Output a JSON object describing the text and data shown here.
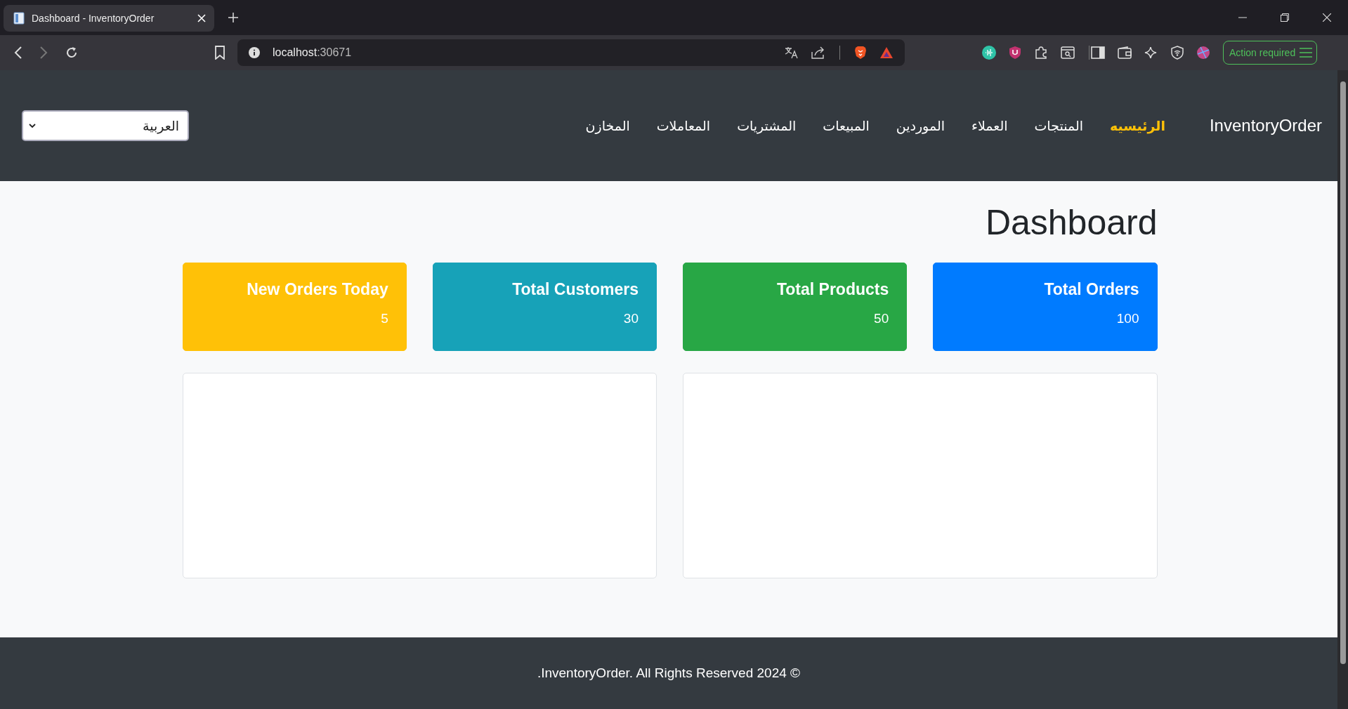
{
  "browser": {
    "tab_title": "Dashboard - InventoryOrder",
    "url_host": "localhost",
    "url_port": ":30671",
    "action_button": "Action required"
  },
  "navbar": {
    "brand": "InventoryOrder",
    "items": [
      {
        "label": "الرئيسيه",
        "selected": true
      },
      {
        "label": "المنتجات",
        "selected": false
      },
      {
        "label": "العملاء",
        "selected": false
      },
      {
        "label": "الموردين",
        "selected": false
      },
      {
        "label": "المبيعات",
        "selected": false
      },
      {
        "label": "المشتريات",
        "selected": false
      },
      {
        "label": "المعاملات",
        "selected": false
      },
      {
        "label": "المخازن",
        "selected": false
      }
    ],
    "language_select": {
      "value": "العربية"
    }
  },
  "page_title": "Dashboard",
  "stat_cards": [
    {
      "title": "Total Orders",
      "value": "100",
      "color": "#007bff"
    },
    {
      "title": "Total Products",
      "value": "50",
      "color": "#28a745"
    },
    {
      "title": "Total Customers",
      "value": "30",
      "color": "#17a2b8"
    },
    {
      "title": "New Orders Today",
      "value": "5",
      "color": "#ffc107"
    }
  ],
  "footer": {
    "text": ".InventoryOrder. All Rights Reserved 2024 ©"
  }
}
